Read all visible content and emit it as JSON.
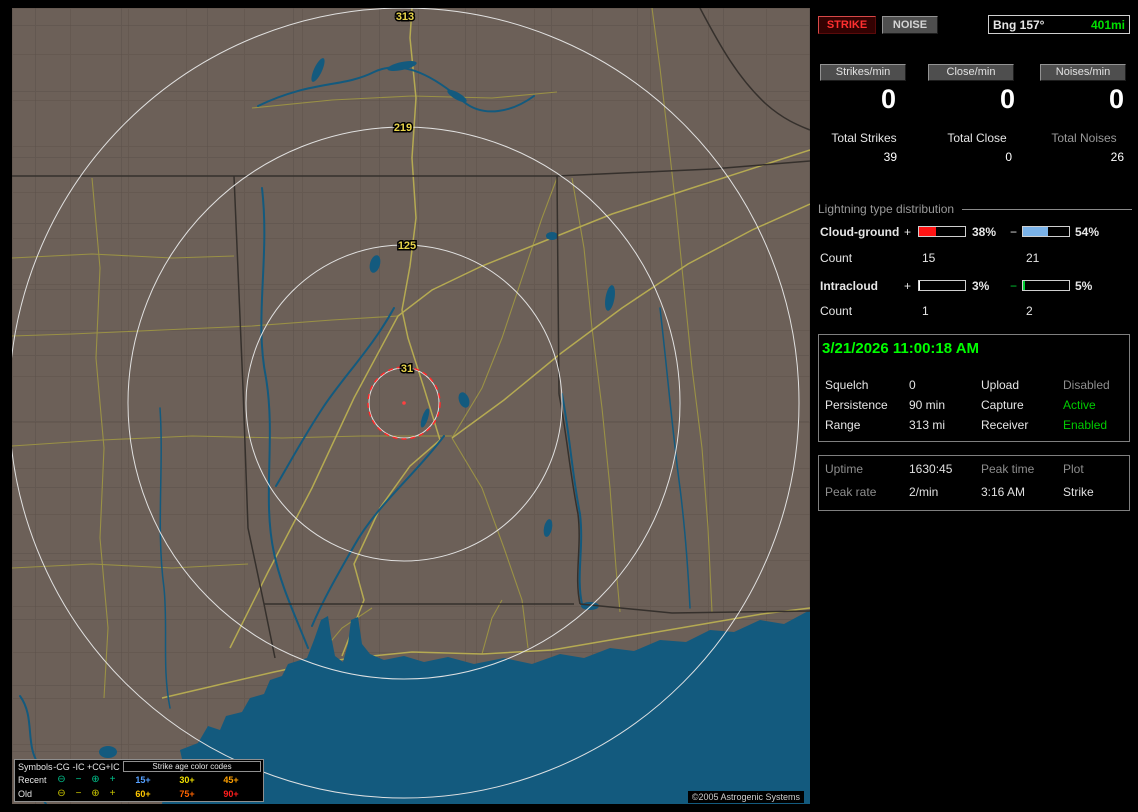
{
  "map": {
    "colors": {
      "land": "#6c6058",
      "water": "#135a7e",
      "roads": "#9a9145",
      "state_border": "#35302c",
      "range_ring": "#e8e8e8",
      "ring_label": "#e8d44a",
      "alert_circle": "#ff2828"
    },
    "ring_labels": [
      "313",
      "219",
      "125",
      "31"
    ],
    "copyright": "©2005 Astrogenic Systems",
    "legend": {
      "symbols_header": "Symbols",
      "type_headers": [
        "-CG",
        "-IC",
        "+CG",
        "+IC"
      ],
      "age_header": "Strike age color codes",
      "rows": [
        {
          "label": "Recent",
          "symbol_color": "#00c08a",
          "symbols": [
            "⊖",
            "−",
            "⊕",
            "+"
          ],
          "ages": [
            {
              "text": "15+",
              "color": "#55a0ff"
            },
            {
              "text": "30+",
              "color": "#f0e000"
            },
            {
              "text": "45+",
              "color": "#ffa000"
            }
          ]
        },
        {
          "label": "Old",
          "symbol_color": "#c8c400",
          "symbols": [
            "⊖",
            "−",
            "⊕",
            "+"
          ],
          "ages": [
            {
              "text": "60+",
              "color": "#ffc800"
            },
            {
              "text": "75+",
              "color": "#ff6400"
            },
            {
              "text": "90+",
              "color": "#ff1e1e"
            }
          ]
        }
      ]
    }
  },
  "panel": {
    "strike_button": "STRIKE",
    "noise_button": "NOISE",
    "bearing": "Bng 157°",
    "bearing_range": "401mi",
    "rate_boxes": [
      {
        "label": "Strikes/min",
        "value": "0"
      },
      {
        "label": "Close/min",
        "value": "0"
      },
      {
        "label": "Noises/min",
        "value": "0"
      }
    ],
    "totals": [
      {
        "label": "Total Strikes",
        "value": "39",
        "label_color": "#e6e6e6"
      },
      {
        "label": "Total Close",
        "value": "0",
        "label_color": "#e6e6e6"
      },
      {
        "label": "Total Noises",
        "value": "26",
        "label_color": "#9a9a9a"
      }
    ],
    "distribution": {
      "title": "Lightning type distribution",
      "rows": [
        {
          "label": "Cloud-ground",
          "plus_sign": "+",
          "plus_pct": 38,
          "plus_pct_label": "38%",
          "plus_color": "#ff1414",
          "minus_sign": "−",
          "minus_sign_color": "#e6e6e6",
          "minus_pct": 54,
          "minus_pct_label": "54%",
          "minus_color": "#7ab2e8",
          "count_label": "Count",
          "plus_count": "15",
          "minus_count": "21"
        },
        {
          "label": "Intracloud",
          "plus_sign": "+",
          "plus_pct": 3,
          "plus_pct_label": "3%",
          "plus_color": "#ffffff",
          "minus_sign": "−",
          "minus_sign_color": "#00cc33",
          "minus_pct": 5,
          "minus_pct_label": "5%",
          "minus_color": "#00cc33",
          "count_label": "Count",
          "plus_count": "1",
          "minus_count": "2"
        }
      ]
    },
    "datetime": "3/21/2026 11:00:18 AM",
    "settings": {
      "rows": [
        {
          "c1": "Squelch",
          "c2": "0",
          "c3": "Upload",
          "c4": "Disabled",
          "c4_color": "#8e8e8e"
        },
        {
          "c1": "Persistence",
          "c2": "90 min",
          "c3": "Capture",
          "c4": "Active",
          "c4_color": "#00cc00"
        },
        {
          "c1": "Range",
          "c2": "313 mi",
          "c3": "Receiver",
          "c4": "Enabled",
          "c4_color": "#00cc00"
        }
      ]
    },
    "status": {
      "rows": [
        {
          "c1": "Uptime",
          "c1_color": "#8e8e8e",
          "c2": "1630:45",
          "c2_color": "#e0e0e0",
          "c3": "Peak time",
          "c3_color": "#8e8e8e",
          "c4": "Plot",
          "c4_color": "#8e8e8e"
        },
        {
          "c1": "Peak rate",
          "c1_color": "#8e8e8e",
          "c2": "2/min",
          "c2_color": "#e0e0e0",
          "c3": "3:16 AM",
          "c3_color": "#e0e0e0",
          "c4": "Strike",
          "c4_color": "#e0e0e0"
        }
      ]
    }
  }
}
